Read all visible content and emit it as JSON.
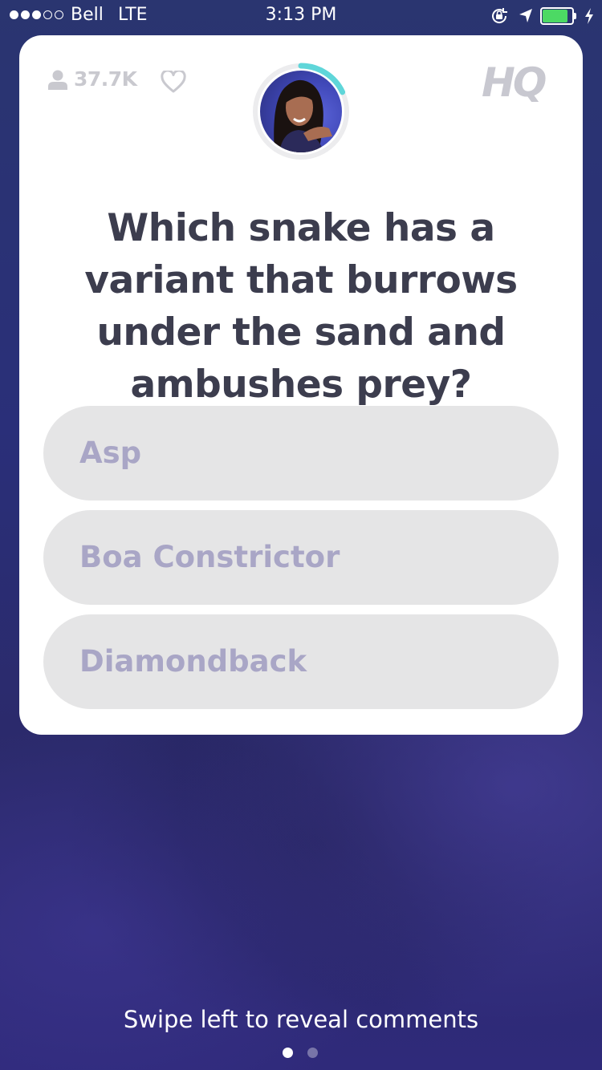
{
  "status_bar": {
    "signal_full": 3,
    "signal_empty": 2,
    "carrier": "Bell",
    "network": "LTE",
    "time": "3:13 PM",
    "battery_level": 0.85,
    "battery_color": "#4cd964"
  },
  "header": {
    "viewer_count": "37.7K",
    "icons": [
      "person-icon",
      "heart-icon"
    ],
    "logo": "HQ"
  },
  "host": {
    "timer_color": "#5fd6d9",
    "timer_remaining_fraction": 0.18
  },
  "question": {
    "text": "Which snake has a variant that burrows under the sand and ambushes prey?"
  },
  "answers": [
    {
      "label": "Asp"
    },
    {
      "label": "Boa Constrictor"
    },
    {
      "label": "Diamondback"
    }
  ],
  "footer": {
    "hint": "Swipe left to reveal comments",
    "page_count": 2,
    "active_page": 1
  },
  "colors": {
    "answer_bg": "#e5e5e6",
    "answer_text": "#a9a6c6",
    "question_text": "#3c3d4e",
    "muted": "#c9c9cf"
  }
}
